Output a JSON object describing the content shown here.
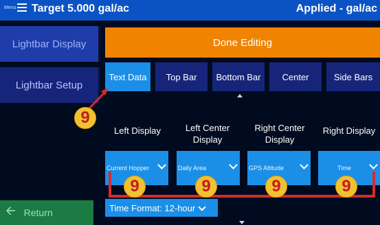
{
  "header": {
    "menu_label": "Menu",
    "target": "Target 5.000 gal/ac",
    "applied": "Applied - gal/ac"
  },
  "sidebar": {
    "lightbar_display": "Lightbar Display",
    "lightbar_setup": "Lightbar Setup",
    "return": "Return"
  },
  "main": {
    "done_editing": "Done Editing",
    "tabs": [
      "Text Data",
      "Top Bar",
      "Bottom Bar",
      "Center",
      "Side Bars"
    ],
    "active_tab": "Text Data",
    "columns": [
      {
        "label_line1": "",
        "label_line2": "Left Display",
        "value": "Current Hopper"
      },
      {
        "label_line1": "Left Center",
        "label_line2": "Display",
        "value": "Daily Area"
      },
      {
        "label_line1": "Right Center",
        "label_line2": "Display",
        "value": "GPS Altitude"
      },
      {
        "label_line1": "",
        "label_line2": "Right Display",
        "value": "Time"
      }
    ],
    "time_format": "Time Format: 12-hour"
  },
  "annotations": {
    "badge_number": "9",
    "colors": {
      "badge_fill": "#f0c232",
      "badge_text": "#c41e1e",
      "bracket": "#d42c2c"
    }
  },
  "colors": {
    "header": "#0b53c5",
    "accent_orange": "#f08400",
    "tab_inactive": "#16257a",
    "tab_active": "#1b8fe8",
    "return_green": "#1c7b43"
  }
}
